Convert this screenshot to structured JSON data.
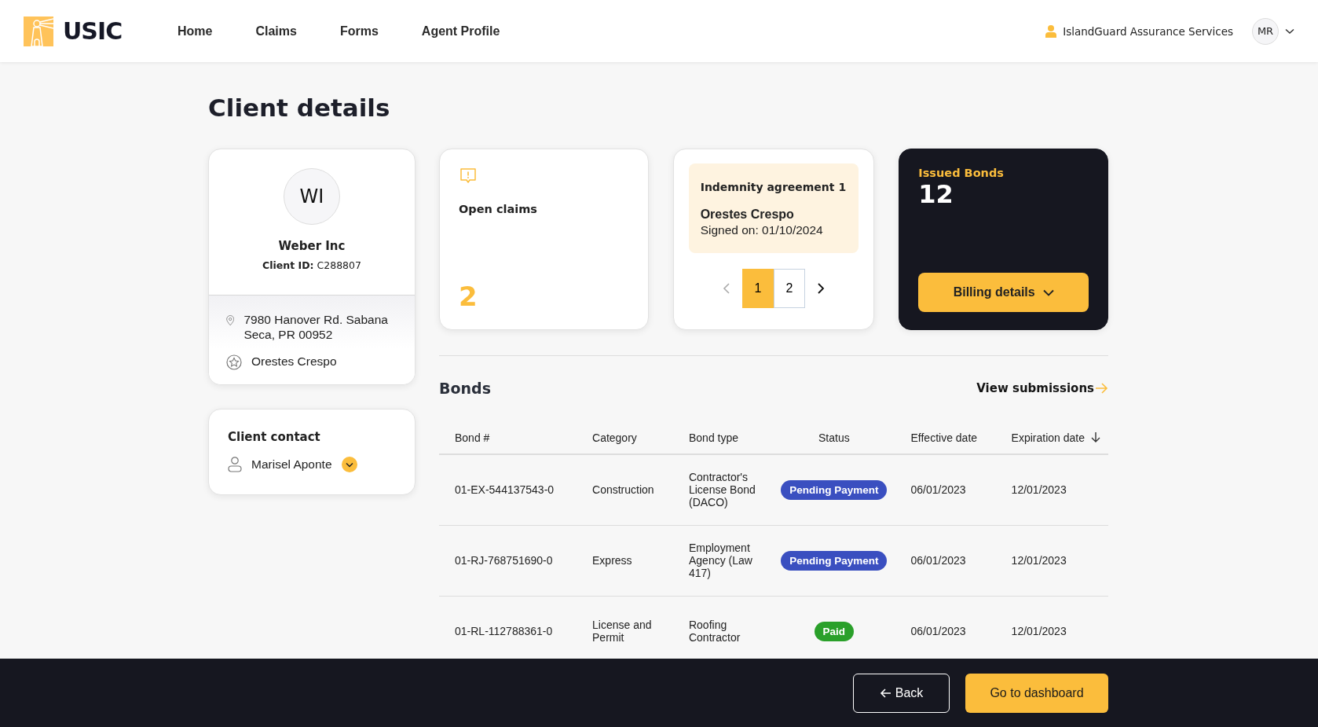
{
  "header": {
    "logo_text": "USIC",
    "nav": [
      {
        "label": "Home",
        "selected": false
      },
      {
        "label": "Claims",
        "selected": false
      },
      {
        "label": "Forms",
        "selected": false
      },
      {
        "label": "Agent Profile",
        "selected": false
      }
    ],
    "agency": "IslandGuard Assurance Services",
    "user_initials": "MR"
  },
  "page_title": "Client details",
  "client_card": {
    "initials": "WI",
    "name": "Weber Inc",
    "client_id_label": "Client ID:",
    "client_id": "C288807",
    "address": "7980 Hanover Rd. Sabana Seca, PR 00952",
    "agent": "Orestes Crespo"
  },
  "contact_card": {
    "title": "Client contact",
    "name": "Marisel Aponte"
  },
  "open_claims": {
    "label": "Open claims",
    "count": "2"
  },
  "indemnity": {
    "title": "Indemnity agreement 1",
    "signer": "Orestes Crespo",
    "signed": "Signed on: 01/10/2024",
    "pages": [
      {
        "label": "1",
        "selected": true
      },
      {
        "label": "2",
        "selected": false
      }
    ]
  },
  "issued_bonds": {
    "label": "Issued Bonds",
    "count": "12",
    "button": "Billing details"
  },
  "bonds": {
    "title": "Bonds",
    "link": "View submissions",
    "columns": [
      "Bond #",
      "Category",
      "Bond type",
      "Status",
      "Effective date",
      "Expiration date"
    ],
    "rows": [
      {
        "bond": "01-EX-544137543-0",
        "category": "Construction",
        "type": "Contractor's License Bond (DACO)",
        "status": "Pending Payment",
        "kind": "pending",
        "effective": "06/01/2023",
        "expiration": "12/01/2023"
      },
      {
        "bond": "01-RJ-768751690-0",
        "category": "Express",
        "type": "Employment Agency (Law 417)",
        "status": "Pending Payment",
        "kind": "pending",
        "effective": "06/01/2023",
        "expiration": "12/01/2023"
      },
      {
        "bond": "01-RL-112788361-0",
        "category": "License and Permit",
        "type": "Roofing Contractor",
        "status": "Paid",
        "kind": "paid",
        "effective": "06/01/2023",
        "expiration": "12/01/2023"
      }
    ]
  },
  "footer": {
    "back": "Back",
    "dashboard": "Go to dashboard"
  }
}
